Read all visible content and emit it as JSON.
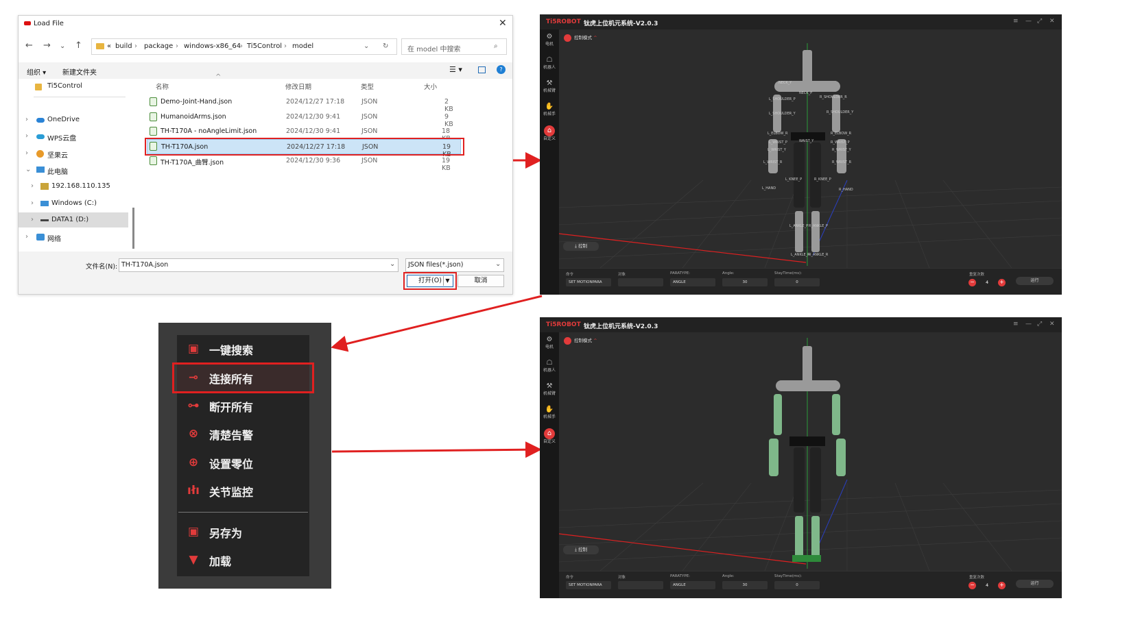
{
  "dialog": {
    "title": "Load File",
    "close": "✕",
    "breadcrumb": [
      "«",
      "build",
      "package",
      "windows-x86_64",
      "Ti5Control",
      "model"
    ],
    "search_placeholder": "在 model 中搜索",
    "toolbar": {
      "organize": "组织 ▾",
      "new_folder": "新建文件夹"
    },
    "sidebar": [
      {
        "label": "Ti5Control",
        "icon": "folder-icon"
      },
      {
        "label": "OneDrive",
        "icon": "cloud-icon"
      },
      {
        "label": "WPS云盘",
        "icon": "cloud-icon"
      },
      {
        "label": "坚果云",
        "icon": "nut-icon"
      },
      {
        "label": "此电脑",
        "icon": "computer-icon"
      },
      {
        "label": "192.168.110.135",
        "icon": "network-drive-icon"
      },
      {
        "label": "Windows (C:)",
        "icon": "drive-icon"
      },
      {
        "label": "DATA1 (D:)",
        "icon": "drive-icon"
      },
      {
        "label": "网络",
        "icon": "network-icon"
      }
    ],
    "columns": {
      "name": "名称",
      "modified": "修改日期",
      "type": "类型",
      "size": "大小"
    },
    "files": [
      {
        "name": "Demo-Joint-Hand.json",
        "modified": "2024/12/27 17:18",
        "type": "JSON",
        "size": "2 KB"
      },
      {
        "name": "HumanoidArms.json",
        "modified": "2024/12/30 9:41",
        "type": "JSON",
        "size": "9 KB"
      },
      {
        "name": "TH-T170A - noAngleLimit.json",
        "modified": "2024/12/30 9:41",
        "type": "JSON",
        "size": "18 KB"
      },
      {
        "name": "TH-T170A.json",
        "modified": "2024/12/27 17:18",
        "type": "JSON",
        "size": "19 KB"
      },
      {
        "name": "TH-T170A_曲臂.json",
        "modified": "2024/12/30 9:36",
        "type": "JSON",
        "size": "19 KB"
      }
    ],
    "filename_label": "文件名(N):",
    "filename_value": "TH-T170A.json",
    "filter_value": "JSON files(*.json)",
    "open_button": "打开(O)",
    "cancel_button": "取消"
  },
  "app": {
    "brand": "Ti5ROBOT",
    "title": "钛虎上位机元系统-V2.0.3",
    "nav": [
      {
        "label": "电机",
        "icon": "motor-icon"
      },
      {
        "label": "机器人",
        "icon": "robot-icon"
      },
      {
        "label": "机械臂",
        "icon": "arm-icon"
      },
      {
        "label": "机械手",
        "icon": "hand-icon"
      },
      {
        "label": "自定义",
        "icon": "custom-icon"
      }
    ],
    "mode": "控制模式",
    "control_button": "⤓ 控制",
    "panel": {
      "cmd_label": "命令",
      "cmd_value": "SET MOTIONPARA",
      "obj_label": "对象",
      "paratype_label": "PARATYPE:",
      "paratype_value": "ANGLE",
      "angle_label": "Angle:",
      "angle_value": "30",
      "stay_label": "StayTime(ms):",
      "stay_value": "0",
      "repeat_label": "重复次数",
      "repeat_value": "4",
      "run_button": "运行"
    },
    "joints": [
      "NECK_Y",
      "NECK_P",
      "L_SHOULDER_P",
      "R_SHOULDER_R",
      "L_SHOULDER_Y",
      "R_SHOULDER_Y",
      "L_ELBOW_R",
      "R_ELBOW_R",
      "WAIST_Y",
      "L_WRIST_P",
      "R_WRIST_P",
      "L_WRIST_Y",
      "R_WRIST_Y",
      "L_WRIST_R",
      "R_WRIST_R",
      "L_KNEE_P",
      "R_KNEE_P",
      "L_HAND",
      "R_HAND",
      "L_ANKLE_P",
      "R_ANKLE_P",
      "L_ANKLE_R",
      "R_ANKLE_R"
    ]
  },
  "menu": [
    {
      "label": "一键搜索",
      "icon": "save-icon"
    },
    {
      "label": "连接所有",
      "icon": "connect-icon"
    },
    {
      "label": "断开所有",
      "icon": "disconnect-icon"
    },
    {
      "label": "清楚告警",
      "icon": "clear-alarm-icon"
    },
    {
      "label": "设置零位",
      "icon": "target-icon"
    },
    {
      "label": "关节监控",
      "icon": "waveform-icon"
    },
    {
      "label": "另存为",
      "icon": "save-icon"
    },
    {
      "label": "加载",
      "icon": "folder-load-icon"
    }
  ],
  "colors": {
    "accent": "#e23b3b",
    "highlight": "#e02020",
    "selection": "#cce4f7"
  }
}
